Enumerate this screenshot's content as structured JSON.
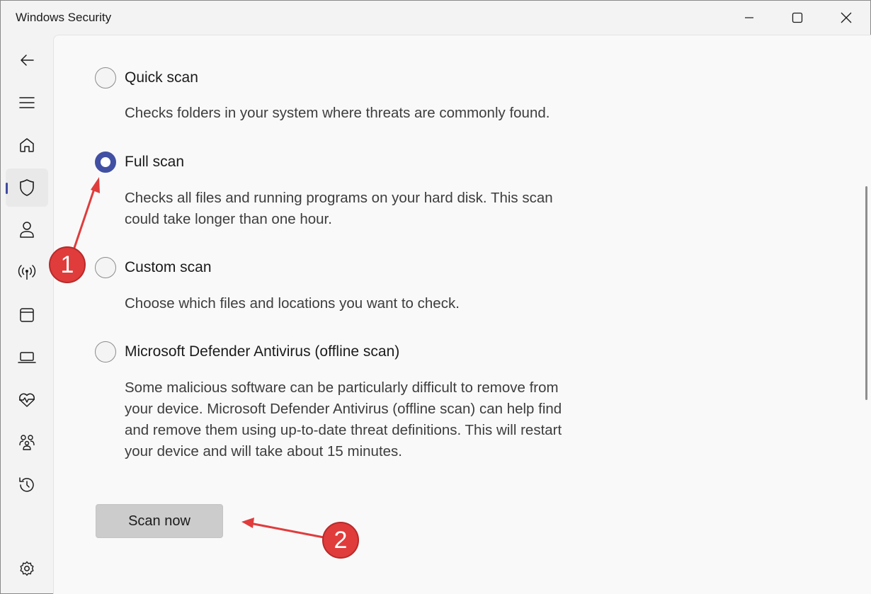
{
  "window": {
    "title": "Windows Security"
  },
  "sidebar": {
    "items": [
      {
        "name": "back",
        "icon": "back-arrow-icon"
      },
      {
        "name": "menu",
        "icon": "hamburger-icon"
      },
      {
        "name": "home",
        "icon": "home-icon"
      },
      {
        "name": "virus-threat-protection",
        "icon": "shield-icon",
        "active": true
      },
      {
        "name": "account-protection",
        "icon": "person-icon"
      },
      {
        "name": "firewall-network",
        "icon": "wireless-antenna-icon"
      },
      {
        "name": "app-browser-control",
        "icon": "app-window-icon"
      },
      {
        "name": "device-security",
        "icon": "laptop-icon"
      },
      {
        "name": "device-performance-health",
        "icon": "heart-pulse-icon"
      },
      {
        "name": "family-options",
        "icon": "family-icon"
      },
      {
        "name": "protection-history",
        "icon": "history-icon"
      },
      {
        "name": "settings",
        "icon": "gear-icon"
      }
    ]
  },
  "scan_options": [
    {
      "label": "Quick scan",
      "selected": false,
      "description": [
        "Checks folders in your system where threats are commonly found."
      ]
    },
    {
      "label": "Full scan",
      "selected": true,
      "description": [
        "Checks all files and running programs on your hard disk. This scan",
        "could take longer than one hour."
      ]
    },
    {
      "label": "Custom scan",
      "selected": false,
      "description": [
        "Choose which files and locations you want to check."
      ]
    },
    {
      "label": "Microsoft Defender Antivirus (offline scan)",
      "selected": false,
      "description": [
        "Some malicious software can be particularly difficult to remove from",
        "your device. Microsoft Defender Antivirus (offline scan) can help find",
        "and remove them using up-to-date threat definitions. This will restart",
        "your device and will take about 15 minutes."
      ]
    }
  ],
  "scan_button": {
    "label": "Scan now"
  },
  "annotations": {
    "step1": "1",
    "step2": "2",
    "color": "#e03c3c"
  },
  "colors": {
    "accent": "#4150a3",
    "content_bg": "#f9f9f9",
    "sidebar_bg": "#f3f3f3",
    "button_bg": "#cccccc"
  }
}
